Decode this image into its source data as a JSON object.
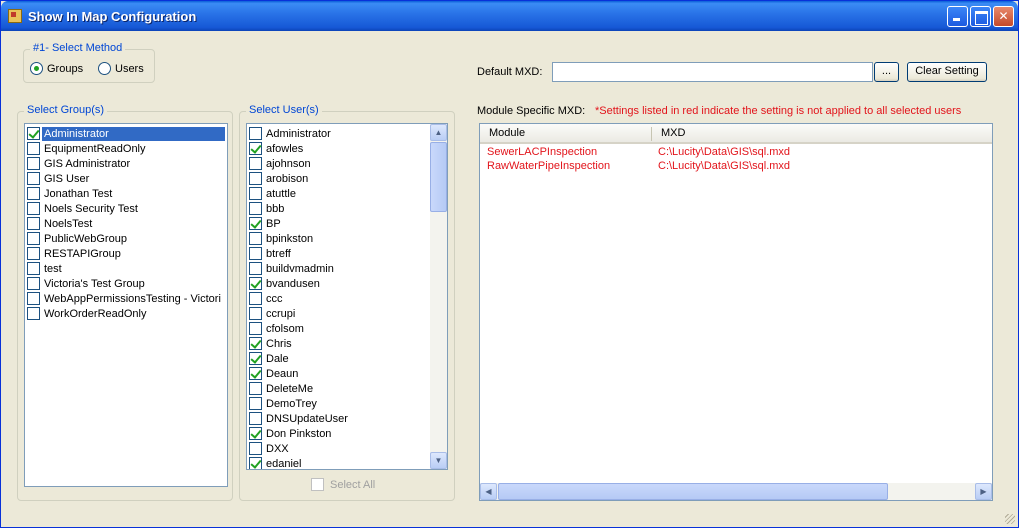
{
  "window": {
    "title": "Show In Map Configuration"
  },
  "method": {
    "legend": "#1- Select Method",
    "options": [
      {
        "label": "Groups",
        "selected": true
      },
      {
        "label": "Users",
        "selected": false
      }
    ]
  },
  "groups": {
    "legend": "Select Group(s)",
    "items": [
      {
        "label": "Administrator",
        "checked": true,
        "selected": true
      },
      {
        "label": "EquipmentReadOnly",
        "checked": false
      },
      {
        "label": "GIS Administrator",
        "checked": false
      },
      {
        "label": "GIS User",
        "checked": false
      },
      {
        "label": "Jonathan Test",
        "checked": false
      },
      {
        "label": "Noels Security Test",
        "checked": false
      },
      {
        "label": "NoelsTest",
        "checked": false
      },
      {
        "label": "PublicWebGroup",
        "checked": false
      },
      {
        "label": "RESTAPIGroup",
        "checked": false
      },
      {
        "label": "test",
        "checked": false
      },
      {
        "label": "Victoria's Test Group",
        "checked": false
      },
      {
        "label": "WebAppPermissionsTesting - Victori",
        "checked": false
      },
      {
        "label": "WorkOrderReadOnly",
        "checked": false
      }
    ]
  },
  "users": {
    "legend": "Select User(s)",
    "items": [
      {
        "label": "Administrator",
        "checked": false
      },
      {
        "label": "afowles",
        "checked": true
      },
      {
        "label": "ajohnson",
        "checked": false
      },
      {
        "label": "arobison",
        "checked": false
      },
      {
        "label": "atuttle",
        "checked": false
      },
      {
        "label": "bbb",
        "checked": false
      },
      {
        "label": "BP",
        "checked": true
      },
      {
        "label": "bpinkston",
        "checked": false
      },
      {
        "label": "btreff",
        "checked": false
      },
      {
        "label": "buildvmadmin",
        "checked": false
      },
      {
        "label": "bvandusen",
        "checked": true
      },
      {
        "label": "ccc",
        "checked": false
      },
      {
        "label": "ccrupi",
        "checked": false
      },
      {
        "label": "cfolsom",
        "checked": false
      },
      {
        "label": "Chris",
        "checked": true
      },
      {
        "label": "Dale",
        "checked": true
      },
      {
        "label": "Deaun",
        "checked": true
      },
      {
        "label": "DeleteMe",
        "checked": false
      },
      {
        "label": "DemoTrey",
        "checked": false
      },
      {
        "label": "DNSUpdateUser",
        "checked": false
      },
      {
        "label": "Don Pinkston",
        "checked": true
      },
      {
        "label": "DXX",
        "checked": false
      },
      {
        "label": "edaniel",
        "checked": true
      }
    ],
    "select_all_label": "Select All"
  },
  "default_mxd": {
    "label": "Default MXD:",
    "value": "",
    "browse_label": "...",
    "clear_label": "Clear Setting"
  },
  "module_mxd": {
    "label": "Module Specific MXD:",
    "note": "*Settings listed in red indicate the setting is not applied to all selected users",
    "columns": [
      "Module",
      "MXD"
    ],
    "rows": [
      {
        "module": "SewerLACPInspection",
        "mxd": "C:\\Lucity\\Data\\GIS\\sql.mxd"
      },
      {
        "module": "RawWaterPipeInspection",
        "mxd": "C:\\Lucity\\Data\\GIS\\sql.mxd"
      }
    ]
  },
  "icons": {
    "title": "app-window-icon",
    "minimize": "minimize-icon",
    "maximize": "maximize-icon",
    "close": "close-icon"
  }
}
